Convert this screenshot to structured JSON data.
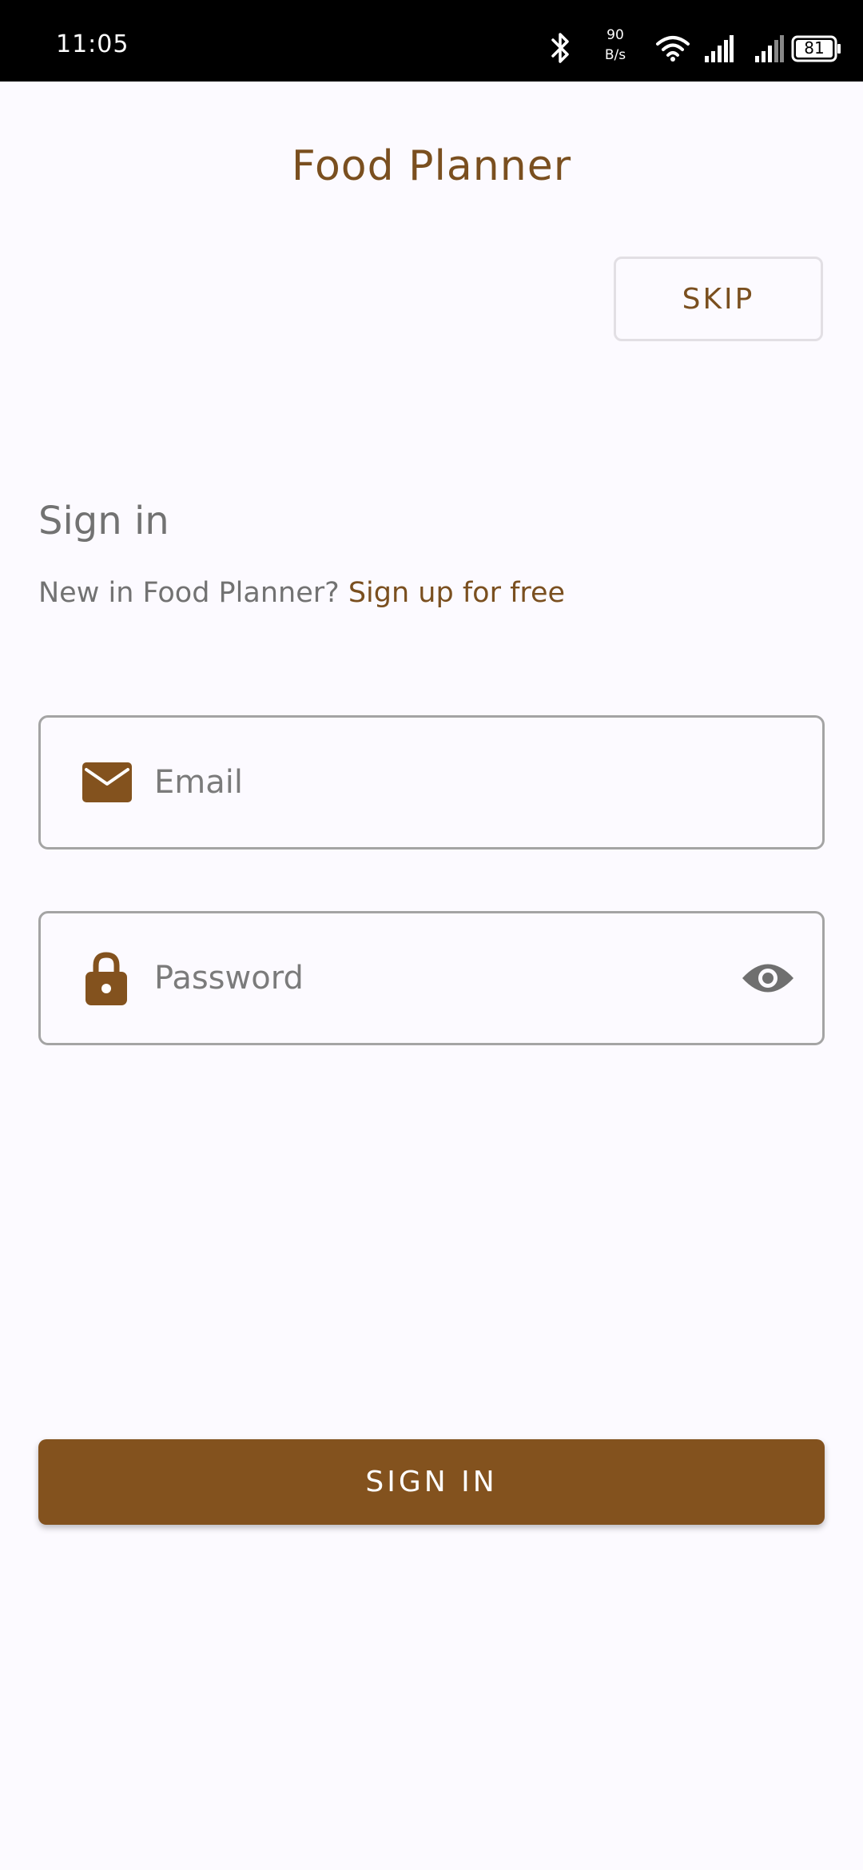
{
  "status_bar": {
    "time": "11:05",
    "net_speed_value": "90",
    "net_speed_unit": "B/s",
    "battery": "81",
    "icons": [
      "bluetooth-icon",
      "wifi-icon",
      "signal-icon",
      "signal-icon",
      "battery-icon"
    ]
  },
  "header": {
    "title": "Food Planner",
    "skip_label": "SKIP"
  },
  "signin": {
    "heading": "Sign in",
    "prompt": "New in Food Planner?",
    "signup_link": "Sign up for free"
  },
  "form": {
    "email_placeholder": "Email",
    "email_icon": "mail-icon",
    "password_placeholder": "Password",
    "password_icon": "lock-icon",
    "visibility_icon": "eye-icon",
    "submit_label": "SIGN IN"
  },
  "colors": {
    "accent": "#83521e",
    "title_text": "#7a4f1f",
    "background": "#fcfaff",
    "field_border": "#a4a4a4"
  }
}
